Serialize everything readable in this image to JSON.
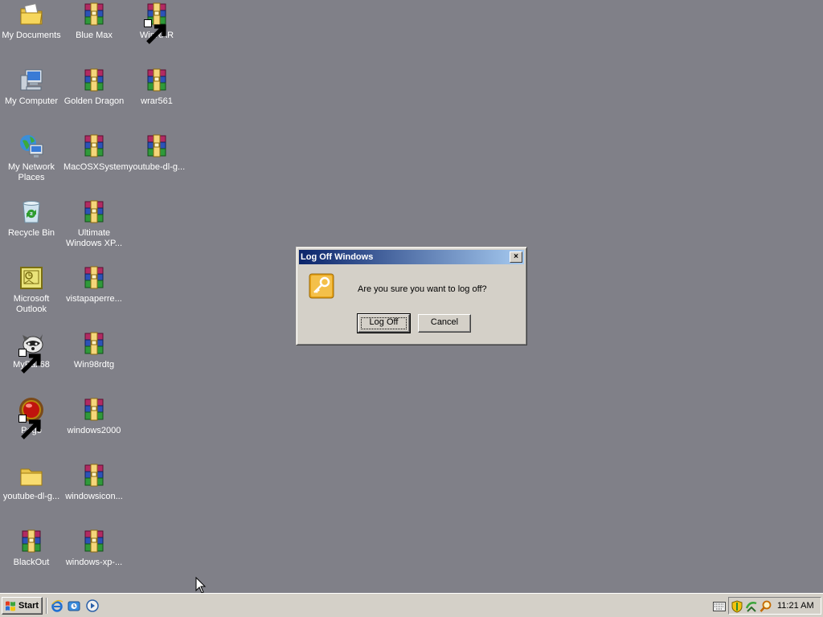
{
  "desktop": {
    "icons": [
      {
        "label": "My Documents",
        "icon": "folder-documents-icon"
      },
      {
        "label": "Blue Max",
        "icon": "winrar-archive-icon"
      },
      {
        "label": "WinRAR",
        "icon": "winrar-archive-icon",
        "shortcut": true
      },
      {
        "label": "My Computer",
        "icon": "computer-icon"
      },
      {
        "label": "Golden Dragon",
        "icon": "winrar-archive-icon"
      },
      {
        "label": "wrar561",
        "icon": "winrar-installer-icon"
      },
      {
        "label": "My Network Places",
        "icon": "network-places-icon"
      },
      {
        "label": "MacOSXSystem",
        "icon": "winrar-archive-icon"
      },
      {
        "label": "youtube-dl-g...",
        "icon": "winrar-archive-icon"
      },
      {
        "label": "Recycle Bin",
        "icon": "recycle-bin-icon"
      },
      {
        "label": "Ultimate Windows XP...",
        "icon": "winrar-archive-icon"
      },
      {
        "label": "Microsoft Outlook",
        "icon": "outlook-icon"
      },
      {
        "label": "vistapaperre...",
        "icon": "winrar-archive-icon"
      },
      {
        "label": "MyPal 68",
        "icon": "mypal-raccoon-icon",
        "shortcut": true
      },
      {
        "label": "Win98rdtg",
        "icon": "winrar-archive-icon"
      },
      {
        "label": "Pego",
        "icon": "pego-red-orb-icon",
        "shortcut": true
      },
      {
        "label": "windows2000",
        "icon": "winrar-archive-icon"
      },
      {
        "label": "youtube-dl-g...",
        "icon": "folder-icon"
      },
      {
        "label": "windowsicon...",
        "icon": "winrar-archive-icon"
      },
      {
        "label": "BlackOut",
        "icon": "winrar-archive-icon"
      },
      {
        "label": "windows-xp-...",
        "icon": "winrar-archive-icon"
      }
    ]
  },
  "dialog": {
    "title": "Log Off Windows",
    "close_label": "×",
    "message": "Are you sure you want to log off?",
    "confirm_label": "Log Off",
    "cancel_label": "Cancel",
    "icon": "key-icon"
  },
  "taskbar": {
    "start_label": "Start",
    "quick_launch": [
      "internet-explorer-icon",
      "outlook-express-icon",
      "media-player-icon"
    ],
    "tray_icons": [
      "keyboard-icon",
      "security-shield-icon",
      "network-icon",
      "search-icon"
    ],
    "clock": "11:21 AM"
  },
  "colors": {
    "desktop_bg": "#808088",
    "title_gradient_start": "#0a246a",
    "title_gradient_end": "#a6caf0",
    "chrome": "#d4d0c8"
  }
}
